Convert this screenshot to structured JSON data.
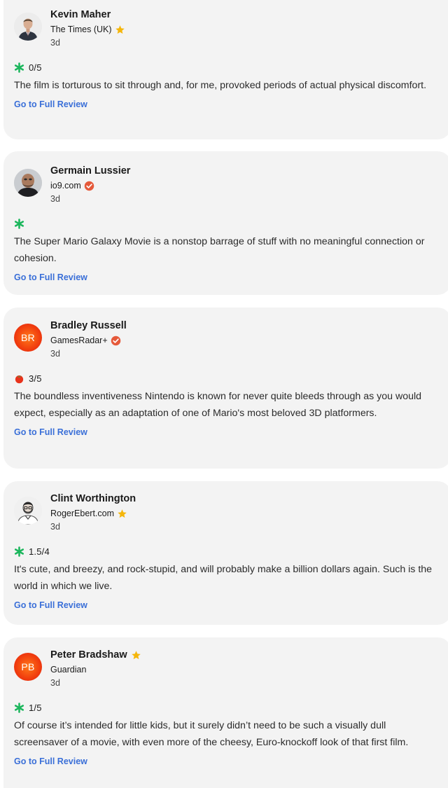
{
  "reviews": [
    {
      "critic": "Kevin Maher",
      "publication": "The Times (UK)",
      "badge": "top-critic-star",
      "age": "3d",
      "score_icon": "splat-icon",
      "score": "0/5",
      "quote": "The film is torturous to sit through and, for me, provoked periods of actual physical discomfort.",
      "link": "Go to Full Review"
    },
    {
      "critic": "Germain Lussier",
      "publication": "io9.com",
      "badge": "verified-check",
      "age": "3d",
      "score_icon": "splat-icon",
      "score": "",
      "quote": "The Super Mario Galaxy Movie is a nonstop barrage of stuff with no meaningful connection or cohesion.",
      "link": "Go to Full Review"
    },
    {
      "critic": "Bradley Russell",
      "initials": "BR",
      "publication": "GamesRadar+",
      "badge": "verified-check",
      "age": "3d",
      "score_icon": "tomato-icon",
      "score": "3/5",
      "quote": "The boundless inventiveness Nintendo is known for never quite bleeds through as you would expect, especially as an adaptation of one of Mario's most beloved 3D platformers.",
      "link": "Go to Full Review"
    },
    {
      "critic": "Clint Worthington",
      "publication": "RogerEbert.com",
      "badge": "top-critic-star",
      "age": "3d",
      "score_icon": "splat-icon",
      "score": "1.5/4",
      "quote": "It's cute, and breezy, and rock-stupid, and will probably make a billion dollars again. Such is the world in which we live.",
      "link": "Go to Full Review"
    },
    {
      "critic": "Peter Bradshaw",
      "initials": "PB",
      "publication": "Guardian",
      "badge": "top-critic-star",
      "age": "3d",
      "score_icon": "splat-icon",
      "score": "1/5",
      "quote": "Of course it’s intended for little kids, but it surely didn’t need to be such a visually dull screensaver of a movie, with even more of the cheesy, Euro-knockoff look of that first film.",
      "link": "Go to Full Review"
    }
  ],
  "colors": {
    "card_bg": "#f3f3f3",
    "link": "#3a6fd8",
    "splat": "#1bb65c",
    "tomato": "#e8321b",
    "star": "#f5b60a",
    "verified": "#e5593a"
  }
}
